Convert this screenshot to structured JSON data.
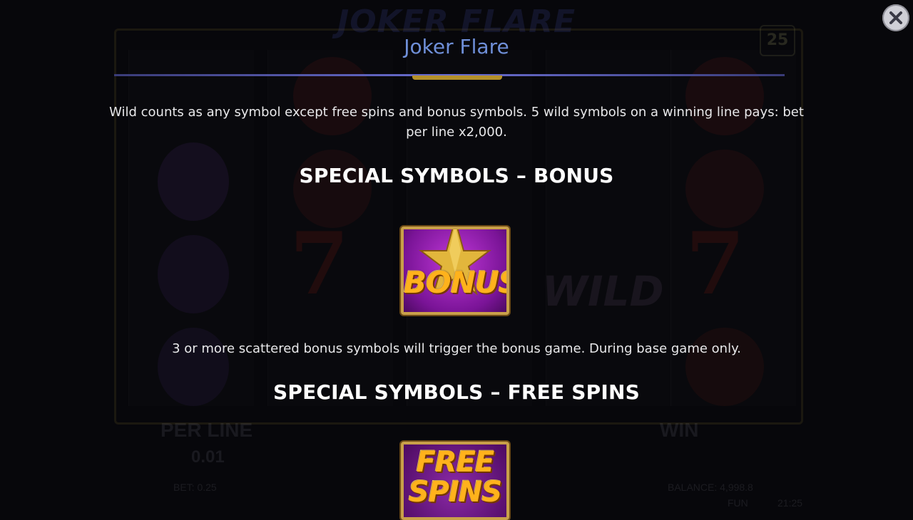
{
  "background": {
    "logo_text": "JOKER FLARE",
    "lines_count": "25",
    "per_line_label": "PER LINE",
    "per_line_value": "0.01",
    "win_label": "WIN",
    "bet_text": "BET: 0.25",
    "balance_text": "BALANCE: 4,998.8",
    "fun_text": "FUN",
    "clock_text": "21:25",
    "wild_text": "WILD"
  },
  "dialog": {
    "title": "Joker Flare",
    "wild_description": "Wild counts as any symbol except free spins and bonus symbols. 5 wild symbols on a winning line pays: bet per line x2,000.",
    "bonus_heading": "SPECIAL SYMBOLS – BONUS",
    "bonus_symbol_text": "BONUS",
    "bonus_description": "3 or more scattered bonus symbols will trigger the bonus game. During base game only.",
    "free_spins_heading": "SPECIAL SYMBOLS – FREE SPINS",
    "free_spins_symbol_text_1": "FREE",
    "free_spins_symbol_text_2": "SPINS"
  },
  "icons": {
    "close": "close-icon",
    "bonus_star": "star-icon"
  },
  "colors": {
    "title": "#6f8fd8",
    "accent_gold": "#b4902a",
    "symbol_purple": "#7a1497",
    "symbol_text_orange": "#ffb21c"
  }
}
